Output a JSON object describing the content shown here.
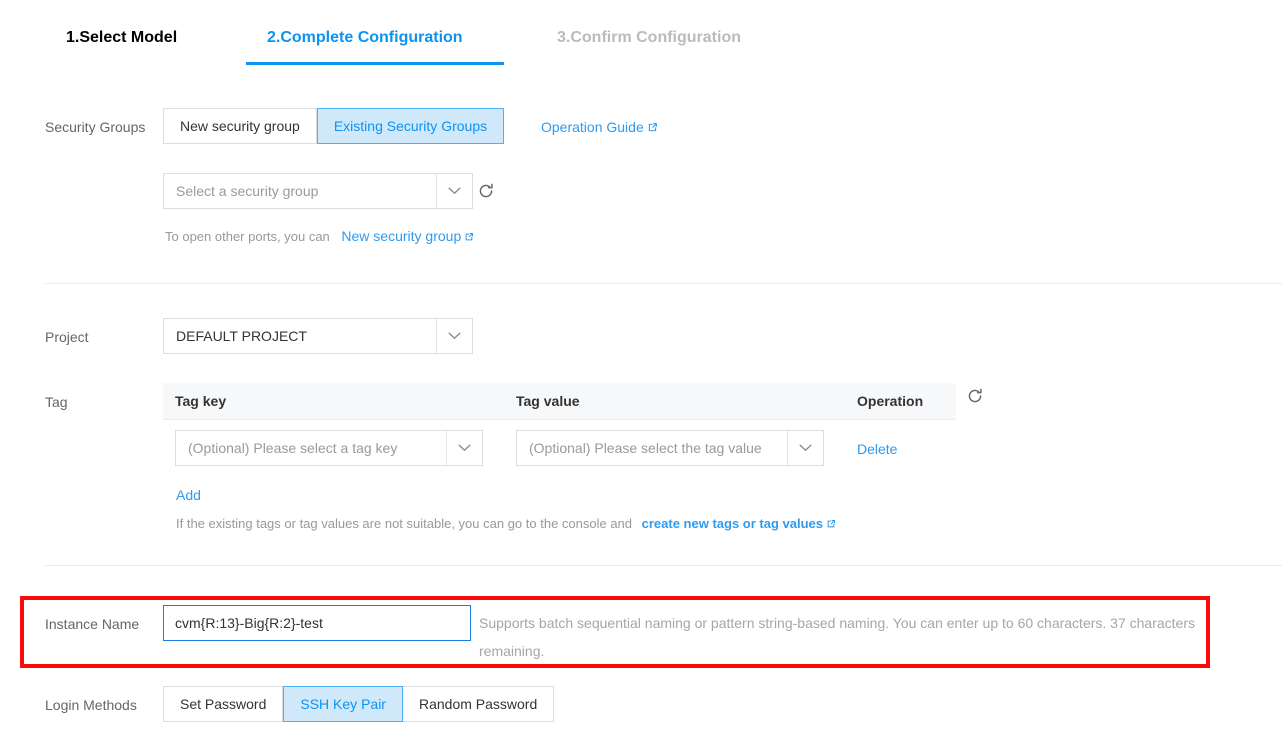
{
  "steps": [
    {
      "label": "1.Select Model",
      "state": "done"
    },
    {
      "label": "2.Complete Configuration",
      "state": "active"
    },
    {
      "label": "3.Confirm Configuration",
      "state": "upcoming"
    }
  ],
  "security_groups": {
    "label": "Security Groups",
    "options": [
      {
        "label": "New security group",
        "selected": false
      },
      {
        "label": "Existing Security Groups",
        "selected": true
      }
    ],
    "guide_link": "Operation Guide",
    "select": {
      "placeholder": "Select a security group",
      "value": ""
    },
    "refresh_icon": "refresh-icon",
    "hint_prefix": "To open other ports, you can",
    "hint_link": "New security group"
  },
  "project": {
    "label": "Project",
    "value": "DEFAULT PROJECT"
  },
  "tag": {
    "label": "Tag",
    "columns": [
      "Tag key",
      "Tag value",
      "Operation"
    ],
    "rows": [
      {
        "key_placeholder": "(Optional) Please select a tag key",
        "key_value": "",
        "value_placeholder": "(Optional) Please select the tag value",
        "value_value": "",
        "operation": "Delete"
      }
    ],
    "add_label": "Add",
    "refresh_icon": "refresh-icon",
    "footer_prefix": "If the existing tags or tag values are not suitable, you can go to the console and",
    "footer_link": "create new tags or tag values"
  },
  "instance_name": {
    "label": "Instance Name",
    "value": "cvm{R:13}-Big{R:2}-test",
    "placeholder": "",
    "helper": "Supports batch sequential naming or pattern string-based naming. You can enter up to 60 characters. 37 characters remaining.",
    "highlight_color": "#fb0a0a"
  },
  "login_methods": {
    "label": "Login Methods",
    "options": [
      {
        "label": "Set Password",
        "selected": false
      },
      {
        "label": "SSH Key Pair",
        "selected": true
      },
      {
        "label": "Random Password",
        "selected": false
      }
    ]
  },
  "colors": {
    "accent": "#0c93f2",
    "link": "#2e9bf0",
    "selected_bg": "#cfe9fb",
    "selected_border": "#4fb0f5",
    "muted": "#999999",
    "divider": "#e8eaec",
    "highlight": "#fb0a0a",
    "focus_border": "#1c7ce8"
  }
}
